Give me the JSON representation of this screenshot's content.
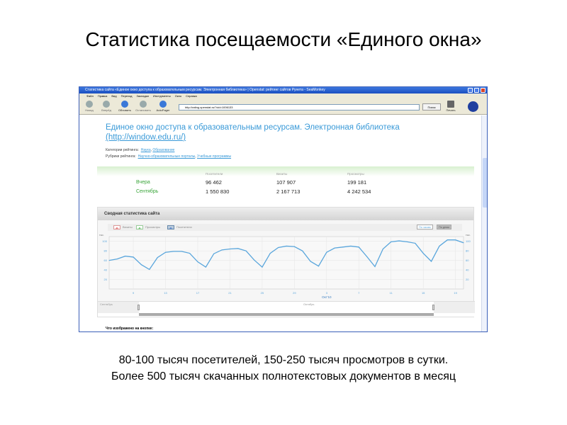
{
  "slide": {
    "title": "Статистика посещаемости «Единого окна»",
    "caption_lines": [
      "80-100 тысяч посетителей, 150-250 тысяч просмотров в сутки.",
      "Более 500 тысяч скачанных полнотекстовых документов в месяц"
    ]
  },
  "browser": {
    "window_title": "Статистика сайта «Единое окно доступа к образовательным ресурсам. Электронная библиотека» | Openstat: рейтинг сайтов Рунета - SeaMonkey",
    "menu": [
      "Файл",
      "Правка",
      "Вид",
      "Переход",
      "Закладки",
      "Инструменты",
      "Окно",
      "Справка"
    ],
    "toolbar": {
      "back": "Назад",
      "forward": "Вперёд",
      "reload": "Обновить",
      "stop": "Остановить",
      "autopager": "AutoPager",
      "search": "Поиск",
      "print": "Печать"
    },
    "url": "http://rating.openstat.ru/?cid=1006133"
  },
  "page": {
    "heading": "Единое окно доступа к образовательным ресурсам. Электронная библиотека",
    "heading_link": "(http://window.edu.ru/)",
    "categories_label": "Категории рейтинга:",
    "categories": [
      "Наука",
      "Образование"
    ],
    "rubrics_label": "Рубрики рейтинга:",
    "rubrics": [
      "Научно-образовательные порталы",
      "Учебные программы"
    ],
    "stats": {
      "columns": [
        "Посетители",
        "Визиты",
        "Просмотры"
      ],
      "rows": [
        {
          "label": "Вчера",
          "values": [
            "96 462",
            "107 907",
            "199 181"
          ]
        },
        {
          "label": "Сентябрь",
          "values": [
            "1 550 830",
            "2 167 713",
            "4 242 534"
          ]
        }
      ]
    },
    "panel_title": "Сводная статистика сайта",
    "legend": [
      "Визиты",
      "Просмотры",
      "Посетители"
    ],
    "mode_buttons": [
      "По часам",
      "По дням"
    ],
    "scroller_labels": [
      "Сентябрь",
      "Октябрь"
    ],
    "what_label": "Что изображено на кнопке:"
  },
  "colors": {
    "line": "#5aa6dc",
    "link": "#3a9ad8",
    "green": "#3aa53a"
  },
  "chart_data": {
    "type": "line",
    "ylabel_left": "тыс.",
    "ylabel_right": "тыс.",
    "yticks": [
      20,
      40,
      60,
      80,
      100
    ],
    "ylim": [
      0,
      110
    ],
    "xticks": [
      "9",
      "13",
      "17",
      "21",
      "25",
      "29",
      "3",
      "7",
      "11",
      "15",
      "19"
    ],
    "xlabel": "Окт'10",
    "grid": true,
    "series": [
      {
        "name": "Посетители",
        "start_date": "2010-09-06",
        "values": [
          60,
          63,
          69,
          67,
          51,
          41,
          66,
          77,
          79,
          79,
          75,
          57,
          46,
          74,
          82,
          84,
          85,
          80,
          61,
          46,
          75,
          87,
          90,
          89,
          80,
          58,
          48,
          77,
          86,
          88,
          90,
          88,
          68,
          47,
          84,
          99,
          101,
          99,
          96,
          75,
          58,
          90,
          103,
          103,
          97
        ]
      }
    ]
  }
}
